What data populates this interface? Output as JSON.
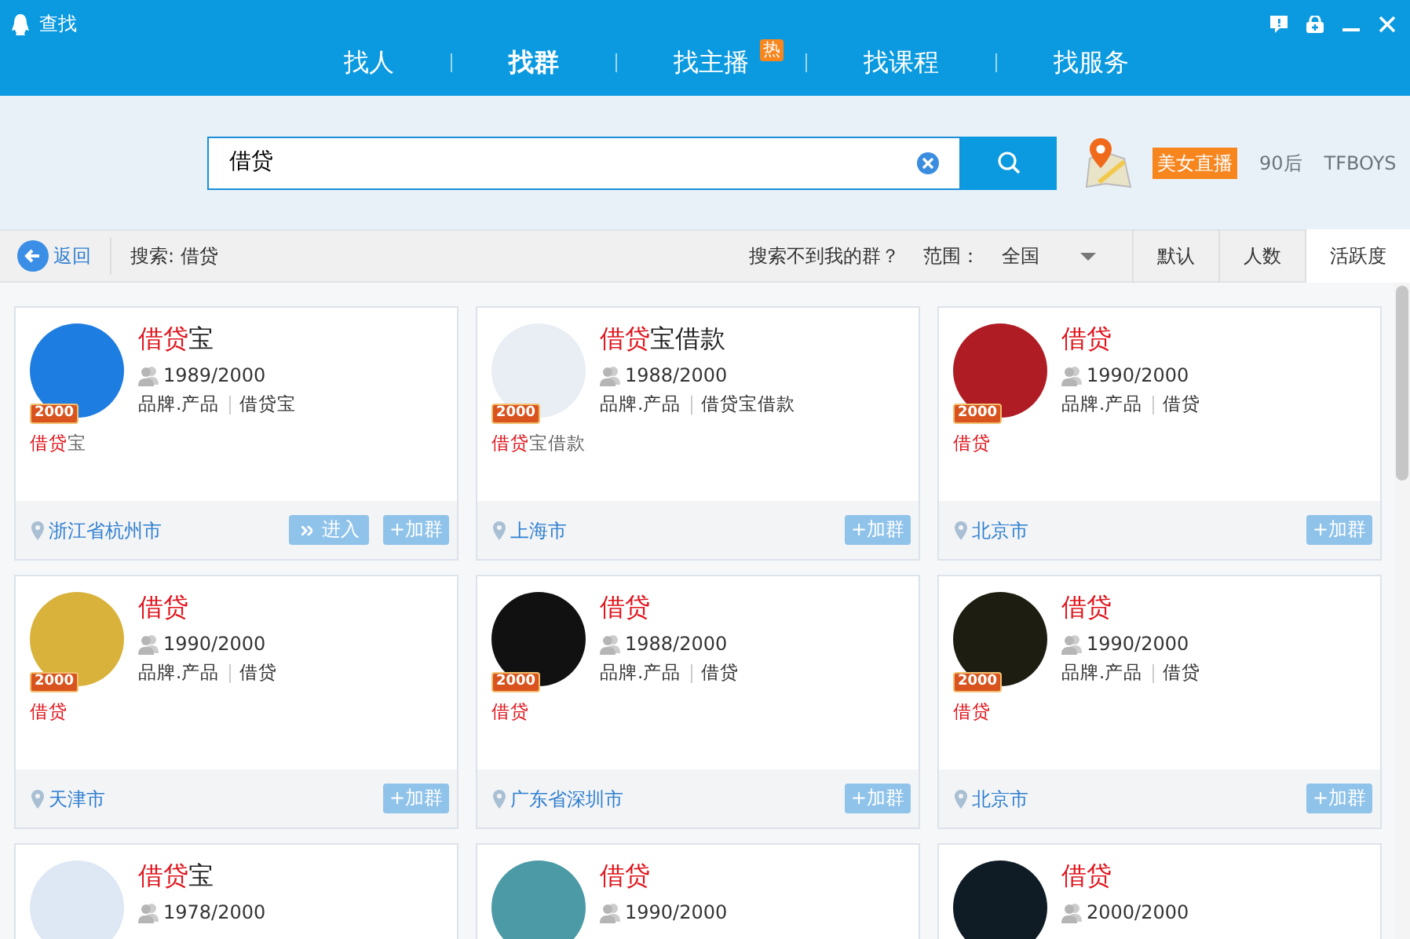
{
  "window": {
    "title": "查找"
  },
  "tabs": [
    {
      "label": "找人",
      "selected": false
    },
    {
      "label": "找群",
      "selected": true
    },
    {
      "label": "找主播",
      "selected": false,
      "badge": "热"
    },
    {
      "label": "找课程",
      "selected": false
    },
    {
      "label": "找服务",
      "selected": false
    }
  ],
  "search": {
    "value": "借贷"
  },
  "hot_tags": [
    {
      "label": "美女直播",
      "kind": "highlight"
    },
    {
      "label": "90后",
      "kind": "plain"
    },
    {
      "label": "TFBOYS",
      "kind": "plain"
    }
  ],
  "toolbar": {
    "back": "返回",
    "query": "搜索: 借贷",
    "help_link": "搜索不到我的群？",
    "scope_label": "范围：",
    "scope_value": "全国"
  },
  "sort_tabs": [
    {
      "label": "默认",
      "selected": false
    },
    {
      "label": "人数",
      "selected": false
    },
    {
      "label": "活跃度",
      "selected": true
    }
  ],
  "groups": [
    {
      "name_match": "借贷",
      "name_rest": "宝",
      "badge": "2000",
      "members": "1989/2000",
      "tags": [
        "品牌.产品",
        "借贷宝"
      ],
      "intro_match": "借贷",
      "intro_rest": "宝",
      "location": "浙江省杭州市",
      "buttons": [
        {
          "label": "进入",
          "kind": "enter"
        },
        {
          "label": "+加群",
          "kind": "join"
        }
      ]
    },
    {
      "name_match": "借贷",
      "name_rest": "宝借款",
      "badge": "2000",
      "members": "1988/2000",
      "tags": [
        "品牌.产品",
        "借贷宝借款"
      ],
      "intro_match": "借贷",
      "intro_rest": "宝借款",
      "location": "上海市",
      "buttons": [
        {
          "label": "+加群",
          "kind": "join"
        }
      ]
    },
    {
      "name_match": "借贷",
      "badge": "2000",
      "members": "1990/2000",
      "tags": [
        "品牌.产品",
        "借贷"
      ],
      "intro_match": "借贷",
      "location": "北京市",
      "buttons": [
        {
          "label": "+加群",
          "kind": "join"
        }
      ]
    },
    {
      "name_match": "借贷",
      "badge": "2000",
      "members": "1990/2000",
      "tags": [
        "品牌.产品",
        "借贷"
      ],
      "intro_match": "借贷",
      "location": "天津市",
      "buttons": [
        {
          "label": "+加群",
          "kind": "join"
        }
      ]
    },
    {
      "name_match": "借贷",
      "badge": "2000",
      "members": "1988/2000",
      "tags": [
        "品牌.产品",
        "借贷"
      ],
      "intro_match": "借贷",
      "location": "广东省深圳市",
      "buttons": [
        {
          "label": "+加群",
          "kind": "join"
        }
      ]
    },
    {
      "name_match": "借贷",
      "badge": "2000",
      "members": "1990/2000",
      "tags": [
        "品牌.产品",
        "借贷"
      ],
      "intro_match": "借贷",
      "location": "北京市",
      "buttons": [
        {
          "label": "+加群",
          "kind": "join"
        }
      ]
    },
    {
      "name_match": "借贷",
      "name_rest": "宝",
      "members": "1978/2000"
    },
    {
      "name_match": "借贷",
      "members": "1990/2000"
    },
    {
      "name_match": "借贷",
      "members": "2000/2000"
    }
  ]
}
